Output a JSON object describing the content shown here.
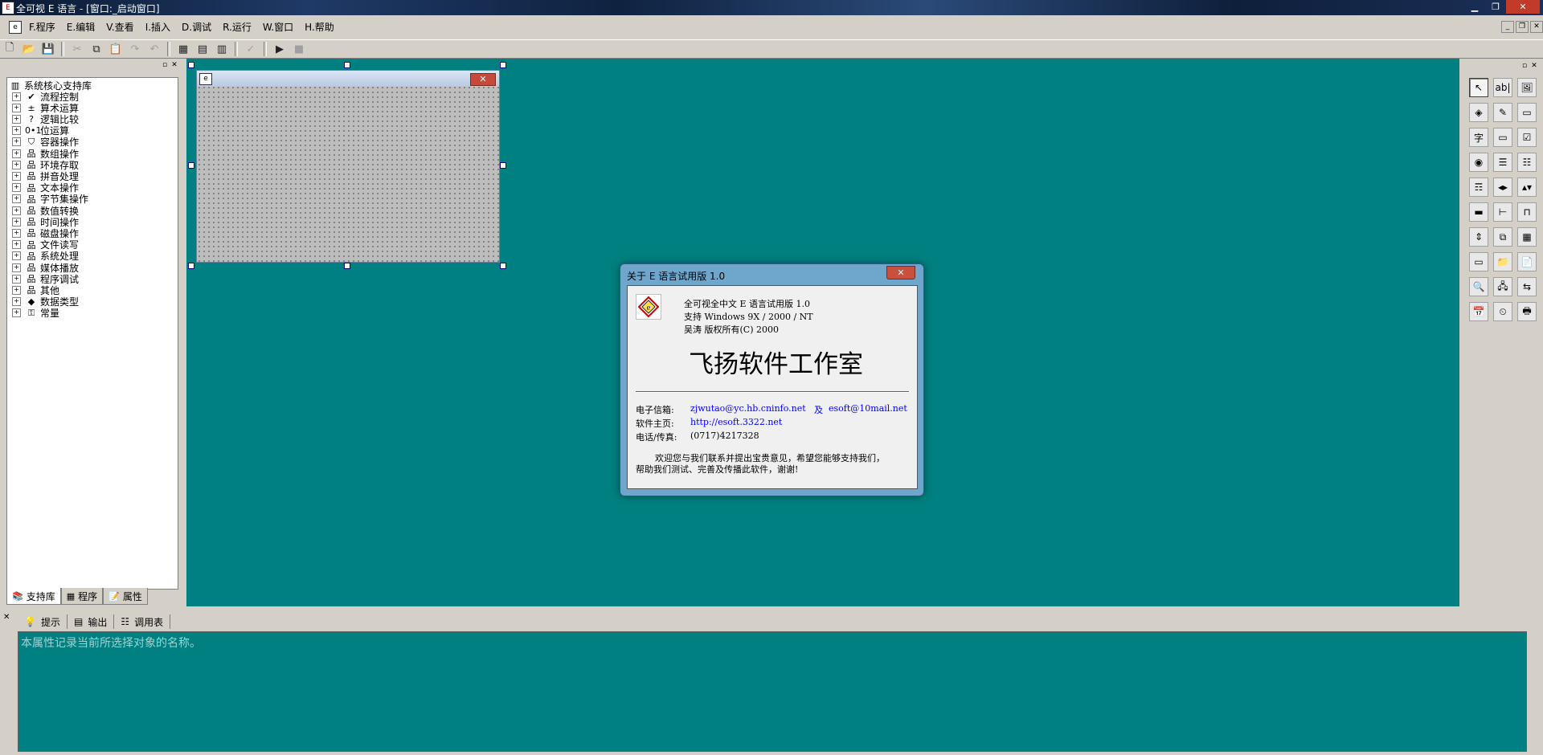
{
  "window": {
    "title": "全可视 E 语言 - [窗口:_启动窗口]",
    "app_icon_glyph": "E",
    "buttons": {
      "minimize": "▁",
      "restore": "❐",
      "close": "✕"
    }
  },
  "menu": {
    "doc_icon": "e",
    "items": [
      "F.程序",
      "E.编辑",
      "V.查看",
      "I.插入",
      "D.调试",
      "R.运行",
      "W.窗口",
      "H.帮助"
    ],
    "mdi_buttons": [
      "_",
      "❐",
      "✕"
    ]
  },
  "toolbar": {
    "items": [
      {
        "name": "new-icon",
        "glyph": "🗋",
        "enabled": true
      },
      {
        "name": "open-icon",
        "glyph": "📂",
        "enabled": true
      },
      {
        "name": "save-icon",
        "glyph": "💾",
        "enabled": true
      },
      {
        "sep": true
      },
      {
        "name": "cut-icon",
        "glyph": "✂",
        "enabled": false
      },
      {
        "name": "copy-icon",
        "glyph": "⧉",
        "enabled": true
      },
      {
        "name": "paste-icon",
        "glyph": "📋",
        "enabled": false
      },
      {
        "name": "redo-icon",
        "glyph": "↷",
        "enabled": false
      },
      {
        "name": "undo-icon",
        "glyph": "↶",
        "enabled": false
      },
      {
        "sep": true
      },
      {
        "name": "layout-icon",
        "glyph": "▦",
        "enabled": true
      },
      {
        "name": "layout2-icon",
        "glyph": "▤",
        "enabled": true
      },
      {
        "name": "layout3-icon",
        "glyph": "▥",
        "enabled": true
      },
      {
        "sep": true
      },
      {
        "name": "check-icon",
        "glyph": "✓",
        "enabled": false
      },
      {
        "sep": true
      },
      {
        "name": "run-icon",
        "glyph": "▶",
        "enabled": true
      },
      {
        "name": "stop-icon",
        "glyph": "■",
        "enabled": false
      }
    ]
  },
  "left_panel": {
    "close_buttons": [
      "▫",
      "✕"
    ],
    "tree": {
      "root": {
        "label": "系统核心支持库",
        "icon": "▥"
      },
      "nodes": [
        {
          "label": "流程控制",
          "icon": "✔"
        },
        {
          "label": "算术运算",
          "icon": "±"
        },
        {
          "label": "逻辑比较",
          "icon": "?"
        },
        {
          "label": "位运算",
          "icon": "0•1"
        },
        {
          "label": "容器操作",
          "icon": "⛉"
        },
        {
          "label": "数组操作",
          "icon": "品"
        },
        {
          "label": "环境存取",
          "icon": "品"
        },
        {
          "label": "拼音处理",
          "icon": "品"
        },
        {
          "label": "文本操作",
          "icon": "品"
        },
        {
          "label": "字节集操作",
          "icon": "品"
        },
        {
          "label": "数值转换",
          "icon": "品"
        },
        {
          "label": "时间操作",
          "icon": "品"
        },
        {
          "label": "磁盘操作",
          "icon": "品"
        },
        {
          "label": "文件读写",
          "icon": "品"
        },
        {
          "label": "系统处理",
          "icon": "品"
        },
        {
          "label": "媒体播放",
          "icon": "品"
        },
        {
          "label": "程序调试",
          "icon": "品"
        },
        {
          "label": "其他",
          "icon": "品"
        },
        {
          "label": "数据类型",
          "icon": "◆"
        },
        {
          "label": "常量",
          "icon": "⚿"
        }
      ]
    },
    "tabs": [
      {
        "label": "支持库",
        "icon": "📚",
        "active": true
      },
      {
        "label": "程序",
        "icon": "▦",
        "active": false
      },
      {
        "label": "属性",
        "icon": "📝",
        "active": false
      }
    ]
  },
  "design_form": {
    "icon": "e",
    "close": "✕"
  },
  "right_panel": {
    "close_buttons": [
      "▫",
      "✕"
    ],
    "tools": [
      {
        "name": "pointer-tool",
        "glyph": "↖",
        "selected": true
      },
      {
        "name": "textbox-tool",
        "glyph": "ab|"
      },
      {
        "name": "picture-tool",
        "glyph": "🖼"
      },
      {
        "name": "shape-tool",
        "glyph": "◈"
      },
      {
        "name": "draw-tool",
        "glyph": "✎"
      },
      {
        "name": "frame-tool",
        "glyph": "▭"
      },
      {
        "name": "label-tool",
        "glyph": "字"
      },
      {
        "name": "button-tool",
        "glyph": "▭"
      },
      {
        "name": "checkbox-tool",
        "glyph": "☑"
      },
      {
        "name": "radio-tool",
        "glyph": "◉"
      },
      {
        "name": "list-tool",
        "glyph": "☰"
      },
      {
        "name": "combo-tool",
        "glyph": "☷"
      },
      {
        "name": "listview-tool",
        "glyph": "☶"
      },
      {
        "name": "hscroll-tool",
        "glyph": "◂▸"
      },
      {
        "name": "vscroll-tool",
        "glyph": "▴▾"
      },
      {
        "name": "progress-tool",
        "glyph": "▬"
      },
      {
        "name": "slider-tool",
        "glyph": "⊢"
      },
      {
        "name": "tab-tool",
        "glyph": "⊓"
      },
      {
        "name": "spin-tool",
        "glyph": "⇕"
      },
      {
        "name": "image-list-tool",
        "glyph": "⧉"
      },
      {
        "name": "grid-tool",
        "glyph": "▦"
      },
      {
        "name": "panel-tool",
        "glyph": "▭"
      },
      {
        "name": "folder-tool",
        "glyph": "📁"
      },
      {
        "name": "file-tool",
        "glyph": "📄"
      },
      {
        "name": "search-tool",
        "glyph": "🔍"
      },
      {
        "name": "network-tool",
        "glyph": "🖧"
      },
      {
        "name": "split-tool",
        "glyph": "⇆"
      },
      {
        "name": "calendar-tool",
        "glyph": "📅"
      },
      {
        "name": "timer-tool",
        "glyph": "⏲"
      },
      {
        "name": "print-tool",
        "glyph": "🖶"
      }
    ]
  },
  "bottom_panel": {
    "close": "✕",
    "tabs": [
      {
        "label": "提示",
        "icon": "💡"
      },
      {
        "label": "输出",
        "icon": "▤"
      },
      {
        "label": "调用表",
        "icon": "☷"
      }
    ],
    "message": "本属性记录当前所选择对象的名称。"
  },
  "about_dialog": {
    "title": "关于 E 语言试用版 1.0",
    "close": "✕",
    "logo_glyph": "e",
    "line1": "全可视全中文 E 语言试用版 1.0",
    "line2": "支持 Windows 9X / 2000 / NT",
    "line3": "吴涛 版权所有(C) 2000",
    "studio": "飞扬软件工作室",
    "email_label": "电子信箱:",
    "email_value1": "zjwutao@yc.hb.cninfo.net",
    "email_and": "及",
    "email_value2": "esoft@10mail.net",
    "home_label": "软件主页:",
    "home_value": "http://esoft.3322.net",
    "phone_label": "电话/传真:",
    "phone_value": "(0717)4217328",
    "welcome1": "欢迎您与我们联系并提出宝贵意见，希望您能够支持我们，",
    "welcome2": "帮助我们测试、完善及传播此软件，谢谢!"
  },
  "colors": {
    "desktop": "#008080",
    "dialog_frame": "#6fa6cc",
    "link": "#0000ff"
  }
}
